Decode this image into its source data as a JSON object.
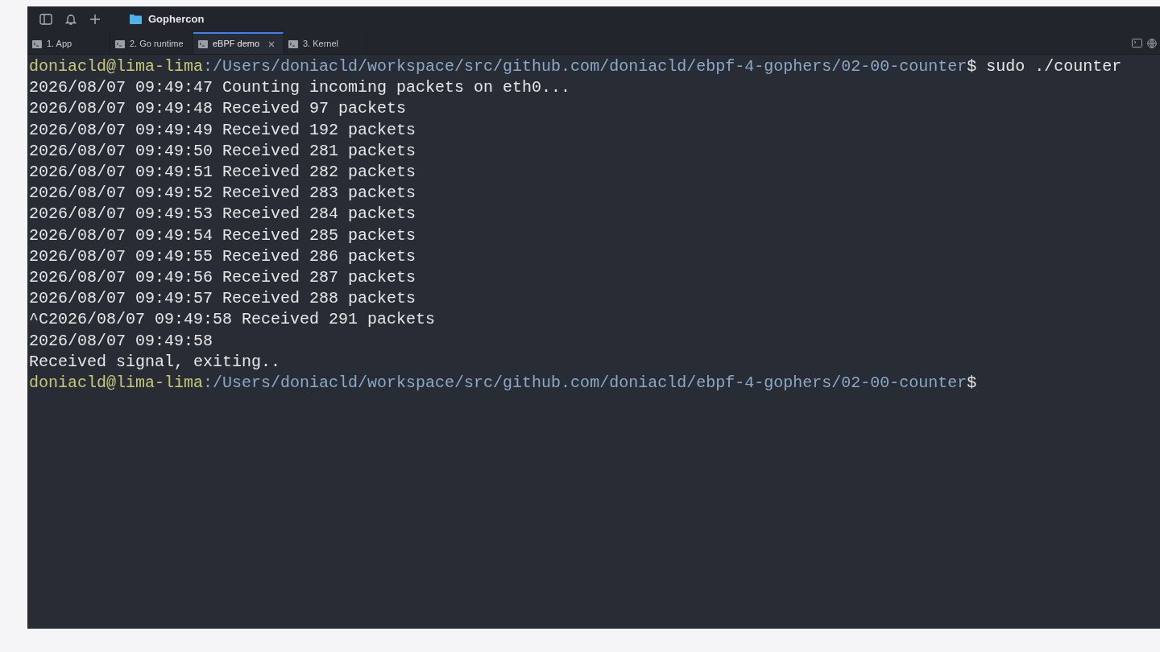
{
  "window": {
    "title": "Gophercon"
  },
  "tabs": [
    {
      "label": "1. App",
      "selected": false
    },
    {
      "label": "2. Go runtime",
      "selected": false
    },
    {
      "label": "eBPF demo",
      "selected": true
    },
    {
      "label": "3. Kernel",
      "selected": false
    }
  ],
  "terminal": {
    "lines": [
      {
        "kind": "prompt",
        "user": "doniacld@lima-lima",
        "path": ":/Users/doniacld/workspace/src/github.com/doniacld/ebpf-4-gophers/02-00-counter",
        "command": "$ sudo ./counter"
      },
      {
        "kind": "output",
        "text": "2026/08/07 09:49:47 Counting incoming packets on eth0..."
      },
      {
        "kind": "output",
        "text": "2026/08/07 09:49:48 Received 97 packets"
      },
      {
        "kind": "output",
        "text": "2026/08/07 09:49:49 Received 192 packets"
      },
      {
        "kind": "output",
        "text": "2026/08/07 09:49:50 Received 281 packets"
      },
      {
        "kind": "output",
        "text": "2026/08/07 09:49:51 Received 282 packets"
      },
      {
        "kind": "output",
        "text": "2026/08/07 09:49:52 Received 283 packets"
      },
      {
        "kind": "output",
        "text": "2026/08/07 09:49:53 Received 284 packets"
      },
      {
        "kind": "output",
        "text": "2026/08/07 09:49:54 Received 285 packets"
      },
      {
        "kind": "output",
        "text": "2026/08/07 09:49:55 Received 286 packets"
      },
      {
        "kind": "output",
        "text": "2026/08/07 09:49:56 Received 287 packets"
      },
      {
        "kind": "output",
        "text": "2026/08/07 09:49:57 Received 288 packets"
      },
      {
        "kind": "output",
        "text": "^C2026/08/07 09:49:58 Received 291 packets"
      },
      {
        "kind": "output",
        "text": "2026/08/07 09:49:58"
      },
      {
        "kind": "output",
        "text": "Received signal, exiting.."
      },
      {
        "kind": "prompt",
        "user": "doniacld@lima-lima",
        "path": ":/Users/doniacld/workspace/src/github.com/doniacld/ebpf-4-gophers/02-00-counter",
        "command": "$"
      }
    ]
  }
}
